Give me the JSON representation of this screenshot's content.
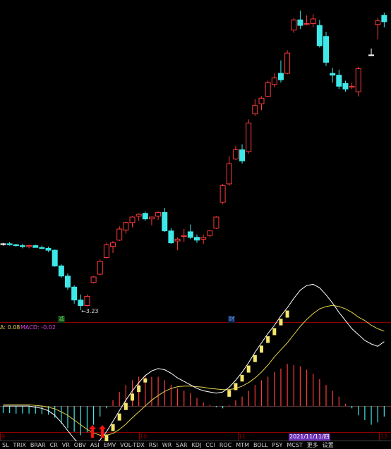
{
  "colors": {
    "up": "#ff3b3b",
    "down": "#3fe8e8",
    "flat": "#ffffff",
    "axis": "#8b0000",
    "dif": "#ffffff",
    "dea": "#e3d24b",
    "macd_up": "#ff3b3b",
    "macd_down": "#3fe8e8",
    "bar_pos": "#f4e66a"
  },
  "price": {
    "low_label": "3.23",
    "markers": [
      {
        "text": "减",
        "color": "#6fd36f"
      },
      {
        "text": "财",
        "color": "#6aa8ff"
      }
    ]
  },
  "indicator": {
    "prefix": "A: 0.08",
    "macd_label": "MACD: -0.02"
  },
  "date_axis": {
    "ticks": [
      "9",
      "10",
      "11",
      "12"
    ],
    "cursor_date": "2021/11/11/四"
  },
  "tabs": [
    "SL",
    "TRIX",
    "BRAR",
    "CR",
    "VR",
    "OBV",
    "ASI",
    "EMV",
    "VOL-TDX",
    "RSI",
    "WR",
    "SAR",
    "KDJ",
    "CCI",
    "ROC",
    "MTM",
    "BOLL",
    "PSY",
    "MCST",
    "更多",
    "设置"
  ],
  "candles": [
    [
      3.95,
      3.96,
      3.93,
      3.95
    ],
    [
      3.95,
      3.97,
      3.93,
      3.94
    ],
    [
      3.94,
      3.95,
      3.92,
      3.93
    ],
    [
      3.93,
      3.95,
      3.9,
      3.92
    ],
    [
      3.92,
      3.94,
      3.9,
      3.93
    ],
    [
      3.93,
      3.94,
      3.91,
      3.91
    ],
    [
      3.91,
      3.93,
      3.89,
      3.9
    ],
    [
      3.9,
      3.92,
      3.86,
      3.88
    ],
    [
      3.88,
      3.89,
      3.7,
      3.71
    ],
    [
      3.71,
      3.73,
      3.58,
      3.6
    ],
    [
      3.6,
      3.63,
      3.45,
      3.48
    ],
    [
      3.48,
      3.5,
      3.3,
      3.34
    ],
    [
      3.34,
      3.4,
      3.23,
      3.28
    ],
    [
      3.28,
      3.4,
      3.27,
      3.38
    ],
    [
      3.53,
      3.6,
      3.52,
      3.59
    ],
    [
      3.62,
      3.78,
      3.61,
      3.76
    ],
    [
      3.8,
      3.96,
      3.79,
      3.94
    ],
    [
      3.92,
      3.98,
      3.85,
      3.96
    ],
    [
      3.99,
      4.14,
      3.98,
      4.11
    ],
    [
      4.1,
      4.19,
      4.06,
      4.18
    ],
    [
      4.18,
      4.25,
      4.13,
      4.24
    ],
    [
      4.25,
      4.28,
      4.2,
      4.27
    ],
    [
      4.28,
      4.3,
      4.2,
      4.22
    ],
    [
      4.22,
      4.24,
      4.15,
      4.24
    ],
    [
      4.25,
      4.3,
      4.21,
      4.29
    ],
    [
      4.29,
      4.34,
      4.08,
      4.09
    ],
    [
      4.09,
      4.12,
      3.95,
      3.96
    ],
    [
      3.98,
      4.02,
      3.88,
      4.0
    ],
    [
      4.03,
      4.11,
      3.97,
      4.04
    ],
    [
      4.08,
      4.16,
      4.0,
      4.02
    ],
    [
      4.02,
      4.05,
      3.96,
      3.99
    ],
    [
      4.0,
      4.05,
      3.95,
      4.02
    ],
    [
      4.04,
      4.1,
      4.02,
      4.09
    ],
    [
      4.12,
      4.25,
      4.11,
      4.24
    ],
    [
      4.4,
      4.6,
      4.38,
      4.58
    ],
    [
      4.6,
      4.9,
      4.58,
      4.82
    ],
    [
      4.87,
      5.01,
      4.86,
      4.97
    ],
    [
      4.97,
      5.03,
      4.82,
      4.85
    ],
    [
      4.95,
      5.3,
      4.93,
      5.26
    ],
    [
      5.36,
      5.52,
      5.34,
      5.45
    ],
    [
      5.47,
      5.55,
      5.4,
      5.53
    ],
    [
      5.55,
      5.72,
      5.54,
      5.7
    ],
    [
      5.68,
      5.8,
      5.65,
      5.75
    ],
    [
      5.8,
      5.94,
      5.7,
      5.73
    ],
    [
      5.8,
      6.05,
      5.79,
      6.02
    ],
    [
      6.27,
      6.4,
      6.24,
      6.38
    ],
    [
      6.38,
      6.48,
      6.28,
      6.32
    ],
    [
      6.33,
      6.43,
      6.32,
      6.34
    ],
    [
      6.34,
      6.44,
      6.3,
      6.39
    ],
    [
      6.32,
      6.38,
      6.08,
      6.1
    ],
    [
      6.2,
      6.25,
      5.88,
      5.92
    ],
    [
      5.8,
      5.86,
      5.7,
      5.78
    ],
    [
      5.78,
      5.84,
      5.63,
      5.66
    ],
    [
      5.69,
      5.72,
      5.6,
      5.63
    ],
    [
      5.65,
      5.7,
      5.63,
      5.66
    ],
    [
      5.6,
      5.87,
      5.55,
      5.85
    ],
    null,
    [
      6.0,
      6.07,
      5.99,
      6.0
    ],
    [
      6.33,
      6.4,
      6.17,
      6.37
    ],
    [
      6.43,
      6.46,
      6.3,
      6.36
    ]
  ],
  "macd": {
    "hist": [
      -0.012,
      -0.012,
      -0.013,
      -0.013,
      -0.013,
      -0.013,
      -0.014,
      -0.015,
      -0.02,
      -0.03,
      -0.038,
      -0.044,
      -0.05,
      -0.045,
      -0.032,
      -0.018,
      -0.004,
      0.01,
      0.024,
      0.036,
      0.044,
      0.05,
      0.052,
      0.05,
      0.05,
      0.044,
      0.036,
      0.03,
      0.026,
      0.022,
      0.014,
      0.006,
      0.002,
      -0.002,
      -0.004,
      0.002,
      0.01,
      0.016,
      0.026,
      0.036,
      0.044,
      0.05,
      0.058,
      0.064,
      0.072,
      0.07,
      0.068,
      0.062,
      0.055,
      0.046,
      0.036,
      0.026,
      0.016,
      0.004,
      -0.004,
      -0.016,
      -0.024,
      -0.032,
      -0.028,
      -0.018
    ],
    "dif": [
      0.0,
      0.0,
      0.0,
      0.0,
      0.0,
      -0.002,
      -0.004,
      -0.008,
      -0.016,
      -0.028,
      -0.042,
      -0.056,
      -0.068,
      -0.072,
      -0.068,
      -0.058,
      -0.044,
      -0.026,
      -0.008,
      0.01,
      0.026,
      0.04,
      0.052,
      0.06,
      0.064,
      0.062,
      0.056,
      0.048,
      0.042,
      0.036,
      0.03,
      0.026,
      0.024,
      0.022,
      0.024,
      0.032,
      0.044,
      0.058,
      0.074,
      0.092,
      0.108,
      0.124,
      0.138,
      0.154,
      0.168,
      0.184,
      0.198,
      0.206,
      0.208,
      0.202,
      0.19,
      0.176,
      0.16,
      0.146,
      0.132,
      0.122,
      0.112,
      0.106,
      0.102,
      0.11
    ],
    "dea": [
      0.002,
      0.002,
      0.002,
      0.002,
      0.002,
      0.001,
      0.0,
      -0.002,
      -0.005,
      -0.01,
      -0.016,
      -0.024,
      -0.032,
      -0.04,
      -0.046,
      -0.05,
      -0.05,
      -0.047,
      -0.04,
      -0.031,
      -0.02,
      -0.01,
      0.0,
      0.01,
      0.018,
      0.025,
      0.03,
      0.033,
      0.034,
      0.034,
      0.033,
      0.032,
      0.03,
      0.029,
      0.028,
      0.028,
      0.03,
      0.034,
      0.04,
      0.048,
      0.058,
      0.07,
      0.084,
      0.096,
      0.108,
      0.122,
      0.136,
      0.148,
      0.158,
      0.166,
      0.17,
      0.172,
      0.17,
      0.166,
      0.16,
      0.152,
      0.146,
      0.138,
      0.132,
      0.128
    ]
  }
}
